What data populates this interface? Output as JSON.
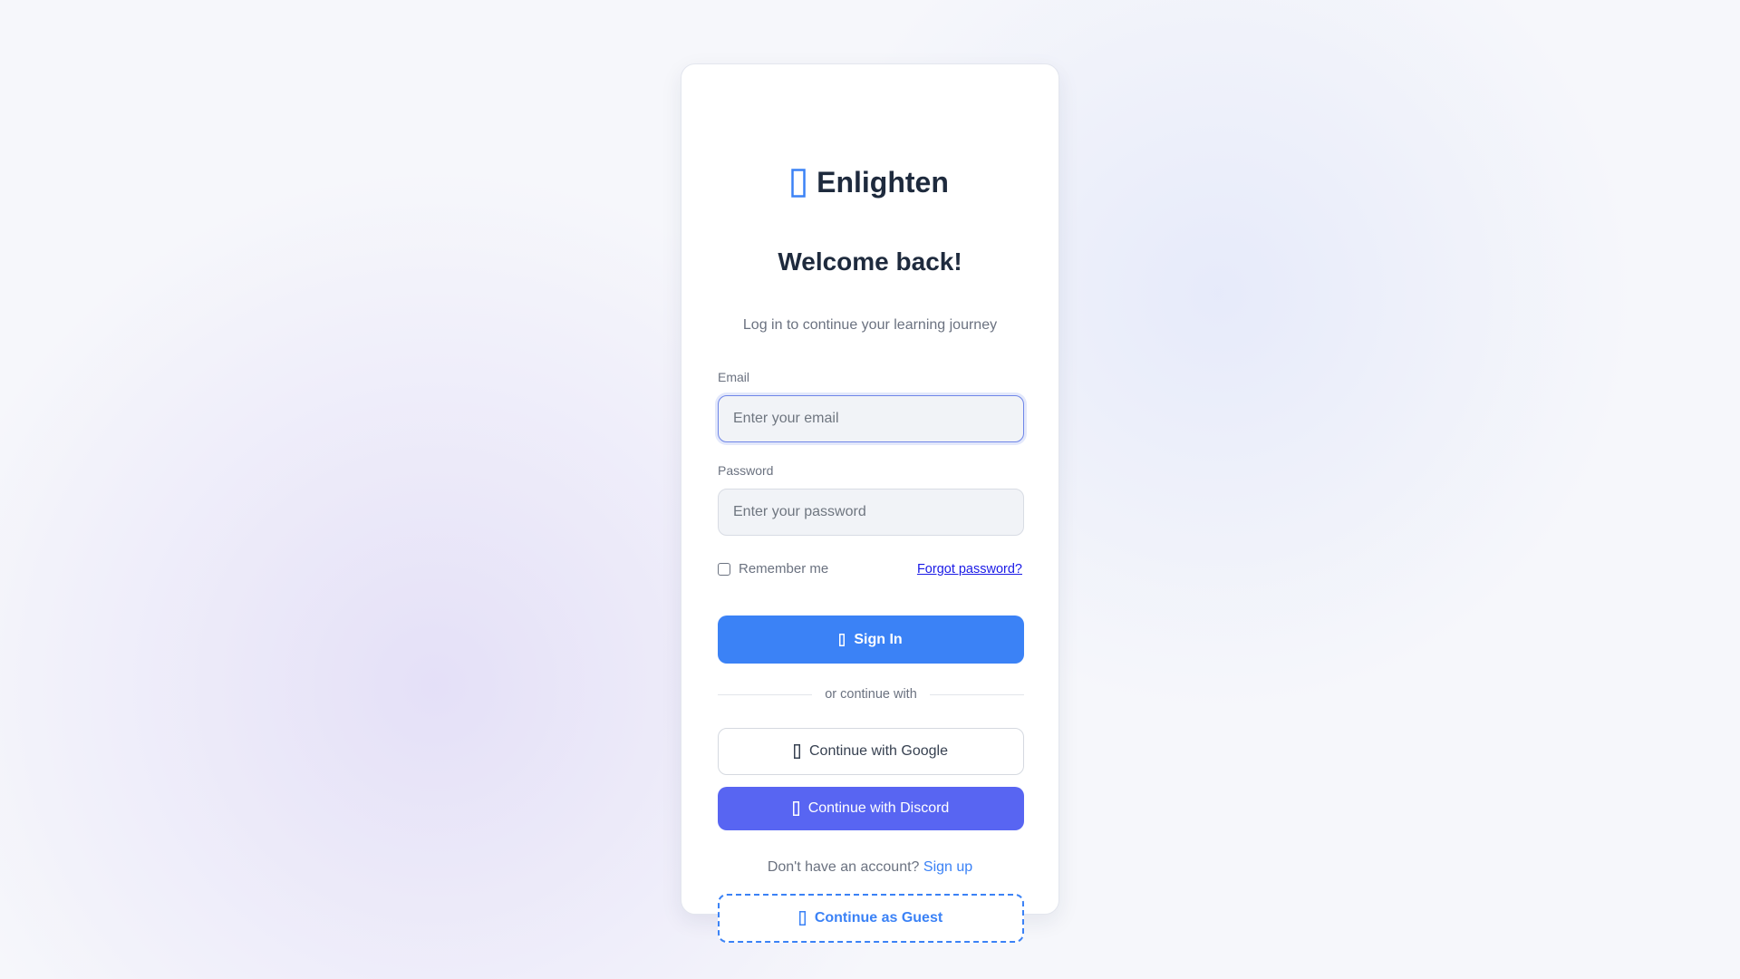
{
  "brand": {
    "name": "Enlighten",
    "icon": "lightbulb-icon"
  },
  "header": {
    "title": "Welcome back!",
    "subtitle": "Log in to continue your learning journey"
  },
  "form": {
    "email_label": "Email",
    "email_placeholder": "Enter your email",
    "email_value": "",
    "password_label": "Password",
    "password_placeholder": "Enter your password",
    "password_value": "",
    "remember_label": "Remember me",
    "remember_checked": false,
    "forgot_label": "Forgot password?",
    "signin_label": "Sign In",
    "signin_icon": "sign-in-icon"
  },
  "social": {
    "divider_label": "or continue with",
    "google_label": "Continue with Google",
    "google_icon": "google-icon",
    "discord_label": "Continue with Discord",
    "discord_icon": "discord-icon"
  },
  "footer": {
    "signup_prompt": "Don't have an account?",
    "signup_link": "Sign up",
    "guest_label": "Continue as Guest",
    "guest_icon": "user-icon"
  },
  "colors": {
    "primary": "#3b82f6",
    "discord": "#5865f2",
    "heading": "#1e2a3d",
    "muted": "#6b7280",
    "link": "#1a1ae6"
  }
}
